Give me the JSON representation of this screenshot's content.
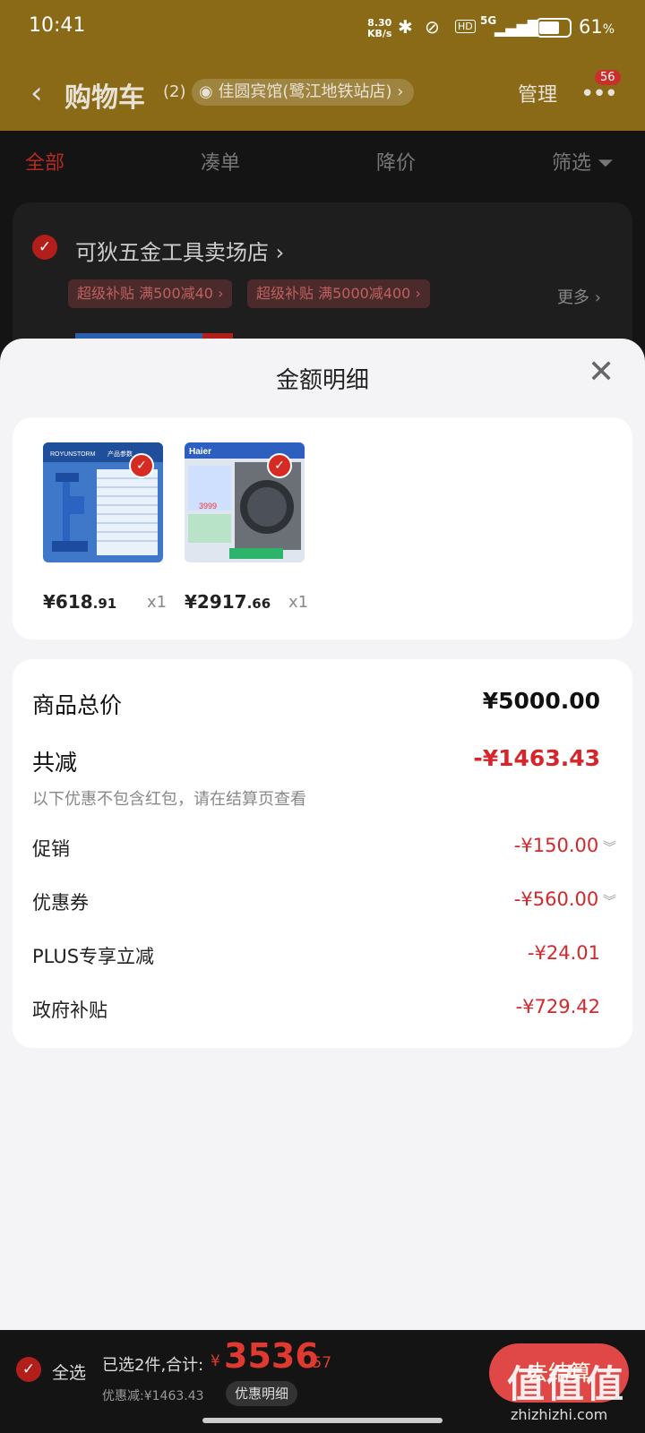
{
  "status_bar": {
    "time": "10:41",
    "net_speed_value": "8.30",
    "net_speed_unit": "KB/s",
    "signal": "5G",
    "hd": "HD",
    "battery": "61",
    "battery_unit": "%"
  },
  "header": {
    "back_icon": "chevron-left-icon",
    "title": "购物车",
    "count": "(2)",
    "location": "佳圆宾馆(鹭江地铁站店)",
    "manage": "管理",
    "badge": "56"
  },
  "tabs": [
    {
      "label": "全部"
    },
    {
      "label": "凑单"
    },
    {
      "label": "降价"
    },
    {
      "label": "筛选"
    }
  ],
  "store": {
    "name": "可狄五金工具卖场店",
    "tags": [
      "超级补贴  满500减40",
      "超级补贴  满5000减400"
    ],
    "more": "更多"
  },
  "sheet": {
    "title": "金额明细",
    "products": [
      {
        "yen": "¥",
        "price_int": "618",
        "price_dec": ".91",
        "qty": "x1",
        "brand": "ROYUNSTORM",
        "thumb_label": "产品参数"
      },
      {
        "yen": "¥",
        "price_int": "2917",
        "price_dec": ".66",
        "qty": "x1",
        "brand": "Haier",
        "thumb_label": "3999"
      }
    ],
    "summary": {
      "total_label": "商品总价",
      "total_value": "¥5000.00",
      "discount_label": "共减",
      "discount_value": "-¥1463.43",
      "note": "以下优惠不包含红包，请在结算页查看",
      "rows": [
        {
          "label": "促销",
          "value": "-¥150.00"
        },
        {
          "label": "优惠券",
          "value": "-¥560.00"
        },
        {
          "label": "PLUS专享立减",
          "value": "-¥24.01"
        },
        {
          "label": "政府补贴",
          "value": "-¥729.42"
        }
      ]
    }
  },
  "bottom_bar": {
    "select_all": "全选",
    "selected_text": "已选2件,合计:",
    "yen": "¥",
    "total_int": "3536",
    "total_dec": ".57",
    "saving": "优惠减:¥1463.43",
    "detail_button": "优惠明细",
    "checkout": "去结算"
  },
  "watermark": {
    "text": "值值值",
    "url": "zhizhizhi.com"
  },
  "colors": {
    "accent_red": "#d6262b",
    "header_gold": "#8a6a17",
    "sheet_bg": "#f4f4f6"
  }
}
